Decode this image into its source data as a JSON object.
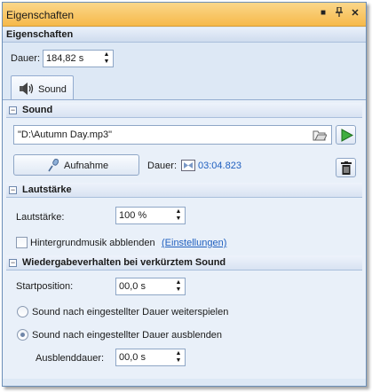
{
  "window": {
    "title": "Eigenschaften"
  },
  "titlebar_buttons": [
    "menu",
    "pin",
    "close"
  ],
  "header": {
    "title": "Eigenschaften"
  },
  "duration": {
    "label": "Dauer:",
    "value": "184,82 s"
  },
  "tabs": [
    {
      "label": "Sound",
      "icon": "speaker-icon",
      "active": true
    }
  ],
  "sound_section": {
    "title": "Sound",
    "file_path": "\"D:\\Autumn Day.mp3\"",
    "record_button": "Aufnahme",
    "duration_label": "Dauer:",
    "duration_value": "03:04.823"
  },
  "volume_section": {
    "title": "Lautstärke",
    "volume_label": "Lautstärke:",
    "volume_value": "100 %",
    "bg_music_label": "Hintergrundmusik abblenden",
    "bg_music_checked": false,
    "settings_link": "(Einstellungen)"
  },
  "playback_section": {
    "title": "Wiedergabeverhalten bei verkürztem Sound",
    "start_label": "Startposition:",
    "start_value": "00,0 s",
    "option_continue": "Sound nach eingestellter Dauer weiterspielen",
    "option_fade": "Sound nach eingestellter Dauer ausblenden",
    "selected_option": "fade",
    "fade_label": "Ausblenddauer:",
    "fade_value": "00,0 s"
  },
  "colors": {
    "accent_title": "#f6b94a",
    "link": "#1f5fbf",
    "play_green": "#2a9a2a"
  }
}
